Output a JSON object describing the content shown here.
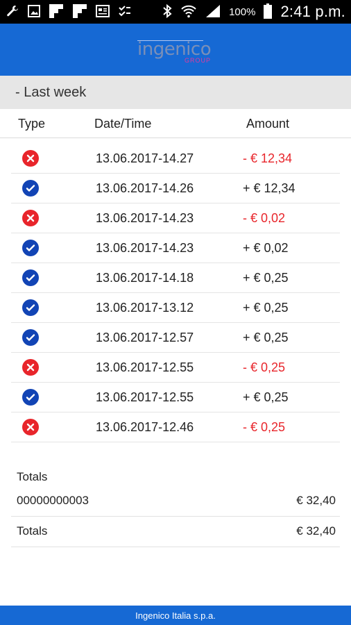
{
  "statusbar": {
    "icons": [
      "wrench-icon",
      "image-icon",
      "flipboard-icon",
      "flipboard-icon",
      "news-icon",
      "checklist-icon"
    ],
    "battery": "100%",
    "time": "2:41 p.m."
  },
  "header": {
    "logo_text": "ingenico",
    "logo_sub": "GROUP"
  },
  "section": {
    "title": "- Last week"
  },
  "columns": {
    "type": "Type",
    "datetime": "Date/Time",
    "amount": "Amount"
  },
  "transactions": [
    {
      "status": "error",
      "datetime": "13.06.2017-14.27",
      "amount": "- € 12,34"
    },
    {
      "status": "ok",
      "datetime": "13.06.2017-14.26",
      "amount": "+ € 12,34"
    },
    {
      "status": "error",
      "datetime": "13.06.2017-14.23",
      "amount": "- € 0,02"
    },
    {
      "status": "ok",
      "datetime": "13.06.2017-14.23",
      "amount": "+ € 0,02"
    },
    {
      "status": "ok",
      "datetime": "13.06.2017-14.18",
      "amount": "+ € 0,25"
    },
    {
      "status": "ok",
      "datetime": "13.06.2017-13.12",
      "amount": "+ € 0,25"
    },
    {
      "status": "ok",
      "datetime": "13.06.2017-12.57",
      "amount": "+ € 0,25"
    },
    {
      "status": "error",
      "datetime": "13.06.2017-12.55",
      "amount": "- € 0,25"
    },
    {
      "status": "ok",
      "datetime": "13.06.2017-12.55",
      "amount": "+ € 0,25"
    },
    {
      "status": "error",
      "datetime": "13.06.2017-12.46",
      "amount": "- € 0,25"
    }
  ],
  "totals": {
    "title": "Totals",
    "rows": [
      {
        "label": "00000000003",
        "value": "€ 32,40"
      },
      {
        "label": "Totals",
        "value": "€ 32,40"
      }
    ]
  },
  "footer": {
    "text": "Ingenico Italia s.p.a."
  },
  "colors": {
    "brand_blue": "#1669d4",
    "ok_blue": "#1244b5",
    "error_red": "#e8252b"
  }
}
